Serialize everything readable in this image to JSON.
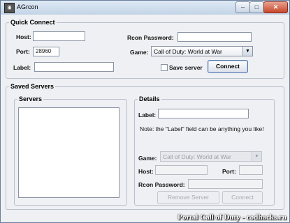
{
  "window": {
    "title": "AGrcon",
    "controls": {
      "minimize": "–",
      "maximize": "□",
      "close": "✕"
    }
  },
  "quick_connect": {
    "legend": "Quick Connect",
    "host_label": "Host:",
    "host_value": "",
    "port_label": "Port:",
    "port_value": "28960",
    "label_label": "Label:",
    "label_value": "",
    "rcon_password_label": "Rcon Password:",
    "rcon_password_value": "",
    "game_label": "Game:",
    "game_value": "Call of Duty: World at War",
    "save_server_label": "Save server",
    "save_server_checked": false,
    "connect_label": "Connect"
  },
  "saved_servers": {
    "legend": "Saved Servers",
    "servers_legend": "Servers",
    "servers_items": [],
    "details": {
      "legend": "Details",
      "label_label": "Label:",
      "label_value": "",
      "note": "Note: the \"Label\" field can be anything you like!",
      "game_label": "Game:",
      "game_value": "Call of Duty: World at War",
      "host_label": "Host:",
      "host_value": "",
      "port_label": "Port:",
      "port_value": "",
      "rcon_password_label": "Rcon Password:",
      "rcon_password_value": "",
      "remove_label": "Remove Server",
      "connect_label": "Connect"
    }
  },
  "watermark": "Portal Call of Duty - codhacks.ru",
  "colors": {
    "accent": "#5576a6",
    "close": "#c7472c",
    "window_bg": "#eef0f3"
  }
}
